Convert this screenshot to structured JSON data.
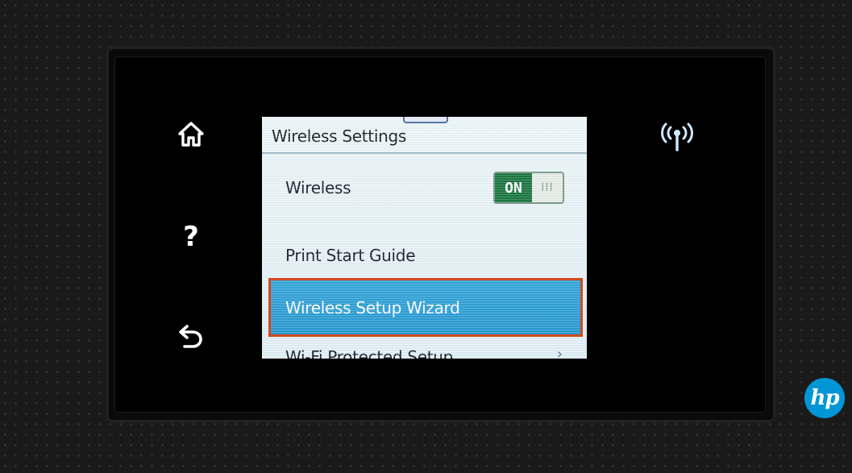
{
  "screen": {
    "title": "Wireless Settings",
    "items": [
      {
        "label": "Wireless",
        "toggle": {
          "state_label": "ON",
          "off_glyph": "III",
          "state": "on"
        }
      },
      {
        "label": "Print Start Guide"
      },
      {
        "label": "Wireless Setup Wizard",
        "highlighted": true
      },
      {
        "label": "Wi-Fi Protected Setup",
        "chevron": "›"
      }
    ]
  },
  "side_buttons": {
    "home": "home-icon",
    "help": {
      "icon": "help-icon",
      "glyph": "?"
    },
    "back": "back-icon",
    "wireless": "wireless-icon"
  },
  "brand": {
    "logo_text": "hp",
    "logo_color": "#0096d6"
  },
  "colors": {
    "highlight": "#2a9bd3",
    "callout_border": "#d24a1e",
    "toggle_on": "#1f7a45"
  }
}
